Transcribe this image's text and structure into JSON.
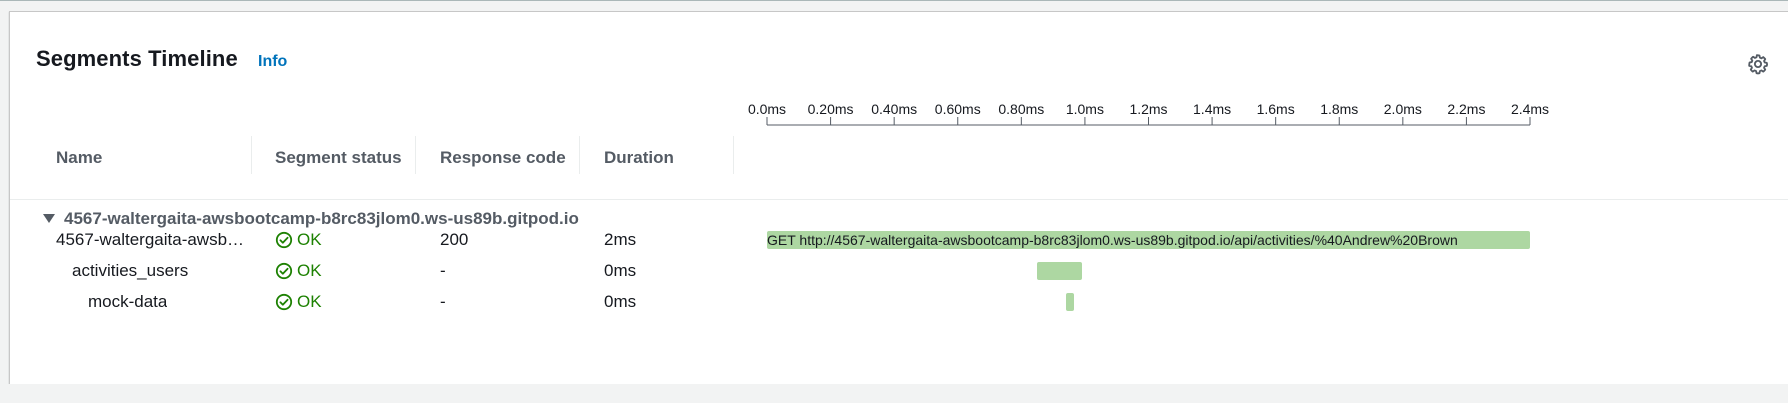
{
  "panel": {
    "title": "Segments Timeline",
    "info_label": "Info",
    "settings_icon": "gear-icon"
  },
  "columns": {
    "name": "Name",
    "status": "Segment status",
    "response": "Response code",
    "duration": "Duration"
  },
  "timeline_axis": {
    "ticks": [
      "0.0ms",
      "0.20ms",
      "0.40ms",
      "0.60ms",
      "0.80ms",
      "1.0ms",
      "1.2ms",
      "1.4ms",
      "1.6ms",
      "1.8ms",
      "2.0ms",
      "2.2ms",
      "2.4ms"
    ],
    "range_ms": [
      0,
      2.4
    ]
  },
  "group": {
    "label": "4567-waltergaita-awsbootcamp-b8rc83jlom0.ws-us89b.gitpod.io",
    "expanded": true
  },
  "segments": [
    {
      "name": "4567-waltergaita-awsbo…",
      "status": "OK",
      "response_code": "200",
      "duration": "2ms",
      "bar_label": "GET http://4567-waltergaita-awsbootcamp-b8rc83jlom0.ws-us89b.gitpod.io/api/activities/%40Andrew%20Brown",
      "start_ms": 0.0,
      "end_ms": 2.4,
      "indent": 0
    },
    {
      "name": "activities_users",
      "status": "OK",
      "response_code": "-",
      "duration": "0ms",
      "bar_label": "",
      "start_ms": 0.85,
      "end_ms": 0.99,
      "indent": 1
    },
    {
      "name": "mock-data",
      "status": "OK",
      "response_code": "-",
      "duration": "0ms",
      "bar_label": "",
      "start_ms": 0.94,
      "end_ms": 0.965,
      "indent": 2
    }
  ],
  "colors": {
    "ok": "#1d8102",
    "bar": "#add7a2",
    "link": "#0073bb"
  }
}
